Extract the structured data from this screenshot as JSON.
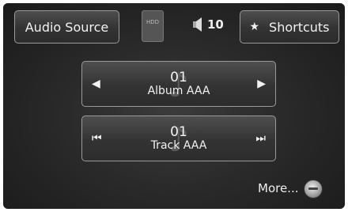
{
  "header": {
    "audio_source_label": "Audio Source",
    "hdd_label": "HDD",
    "volume_value": "10",
    "shortcuts_label": "Shortcuts"
  },
  "album": {
    "number": "01",
    "name": "Album AAA"
  },
  "track": {
    "number": "01",
    "name": "Track AAA"
  },
  "footer": {
    "more_label": "More..."
  },
  "icons": {
    "prev_album": "◀",
    "next_album": "▶",
    "prev_track": "⏮",
    "next_track": "⏭",
    "star": "★",
    "speaker": "speaker-icon"
  }
}
